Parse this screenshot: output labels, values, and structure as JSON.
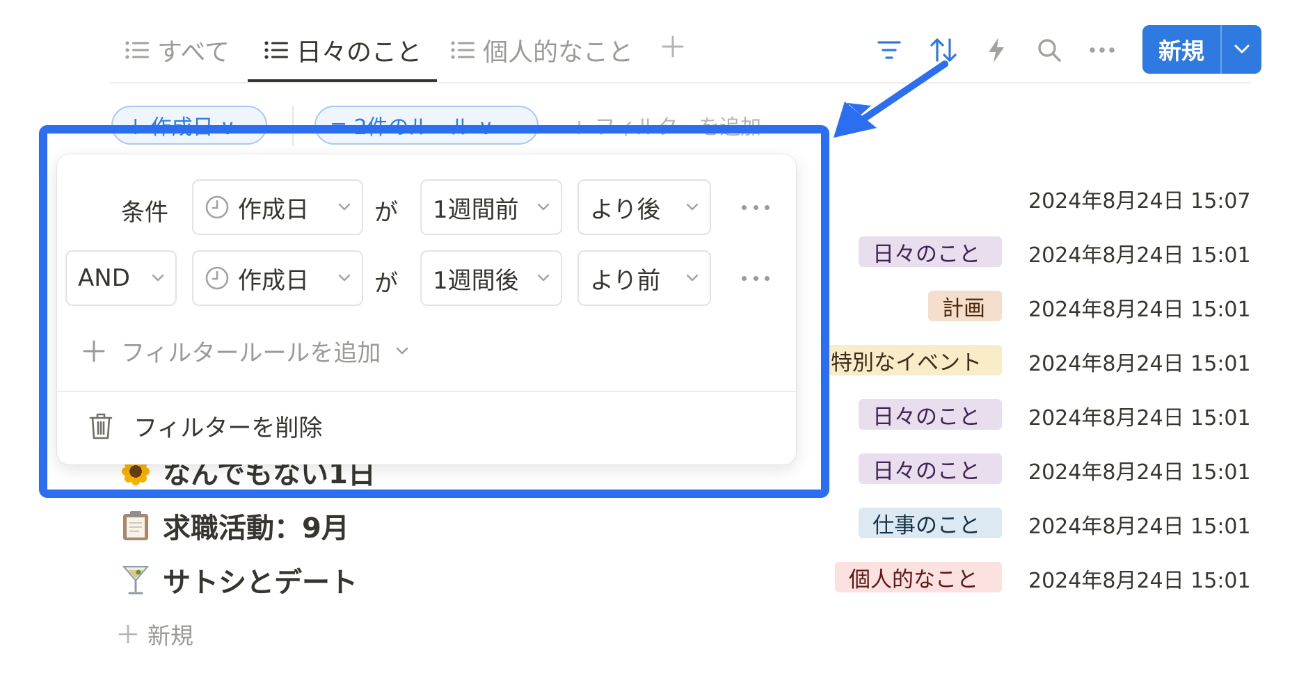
{
  "tabs": [
    {
      "label": "すべて",
      "active": false
    },
    {
      "label": "日々のこと",
      "active": true
    },
    {
      "label": "個人的なこと",
      "active": false
    }
  ],
  "toolbar": {
    "add_view_icon": "plus-icon",
    "filter_icon": "filter-icon",
    "sort_icon": "sort-icon",
    "automation_icon": "lightning-icon",
    "search_icon": "search-icon",
    "more_icon": "ellipsis-icon",
    "new_button_label": "新規",
    "accent_color": "#2f7ae0"
  },
  "filter_bar": {
    "pill_1": "↓ 作成日 ∨",
    "pill_2": "≡ 2件のルール ∨",
    "add_filter": "+ フィルターを追加"
  },
  "filter_popup": {
    "rule1": {
      "label": "条件",
      "property": "作成日",
      "joiner": "が",
      "value": "1週間前",
      "operator": "より後"
    },
    "rule2": {
      "conjunction": "AND",
      "property": "作成日",
      "joiner": "が",
      "value": "1週間後",
      "operator": "より前"
    },
    "add_rule_label": "フィルタールールを追加",
    "delete_label": "フィルターを削除"
  },
  "rows": [
    {
      "title": "",
      "tag": "",
      "date": "2024年8月24日 15:07"
    },
    {
      "title": "",
      "tag": "日々のこと",
      "date": "2024年8月24日 15:01"
    },
    {
      "title": "",
      "tag": "計画",
      "date": "2024年8月24日 15:01"
    },
    {
      "title": "",
      "tag": "特別なイベント",
      "date": "2024年8月24日 15:01"
    },
    {
      "title": "",
      "tag": "日々のこと",
      "date": "2024年8月24日 15:01"
    },
    {
      "title": "なんでもない1日",
      "emoji": "sunflower",
      "tag": "日々のこと",
      "date": "2024年8月24日 15:01"
    },
    {
      "title": "求職活動：9月",
      "emoji": "clipboard",
      "tag": "仕事のこと",
      "date": "2024年8月24日 15:01"
    },
    {
      "title": "サトシとデート",
      "emoji": "cocktail",
      "tag": "個人的なこと",
      "date": "2024年8月24日 15:01"
    }
  ],
  "new_row_label": "新規",
  "tag_colors": {
    "日々のこと": {
      "bg": "#e8deee",
      "fg": "#412454"
    },
    "計画": {
      "bg": "#f5dfcc",
      "fg": "#49290e"
    },
    "特別なイベント": {
      "bg": "#f9ecc9",
      "fg": "#402c1b"
    },
    "仕事のこと": {
      "bg": "#dce9f3",
      "fg": "#183347"
    },
    "個人的なこと": {
      "bg": "#fbe1e0",
      "fg": "#5d1715"
    }
  },
  "highlight_color": "#2b6ef0"
}
